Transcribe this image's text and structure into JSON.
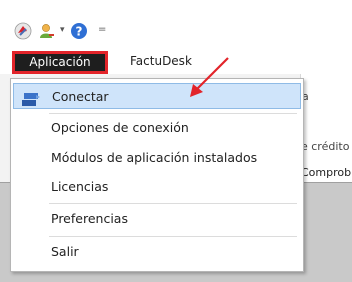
{
  "qat": {
    "icons": [
      "app-logo-icon",
      "user-icon",
      "help-icon",
      "customize-arrow-icon"
    ]
  },
  "menubar": {
    "tabs": [
      {
        "label": "Aplicación",
        "active": true
      },
      {
        "label": "FactuDesk",
        "active": false
      }
    ]
  },
  "dropdown": {
    "items": [
      {
        "label": "Conectar",
        "icon": "connect-icon",
        "highlighted": true
      },
      {
        "label": "Opciones de conexión"
      },
      {
        "label": "Módulos de aplicación instalados"
      },
      {
        "label": "Licencias"
      },
      {
        "label": "Preferencias"
      },
      {
        "label": "Salir"
      }
    ]
  },
  "background": {
    "text_a": "a",
    "text_credito": "e crédito",
    "text_comprob": "Comprob"
  },
  "colors": {
    "active_tab_bg": "#1e1e1e",
    "highlight_border": "#e2242a",
    "hover_bg": "#cfe4fa",
    "arrow": "#e2242a"
  }
}
